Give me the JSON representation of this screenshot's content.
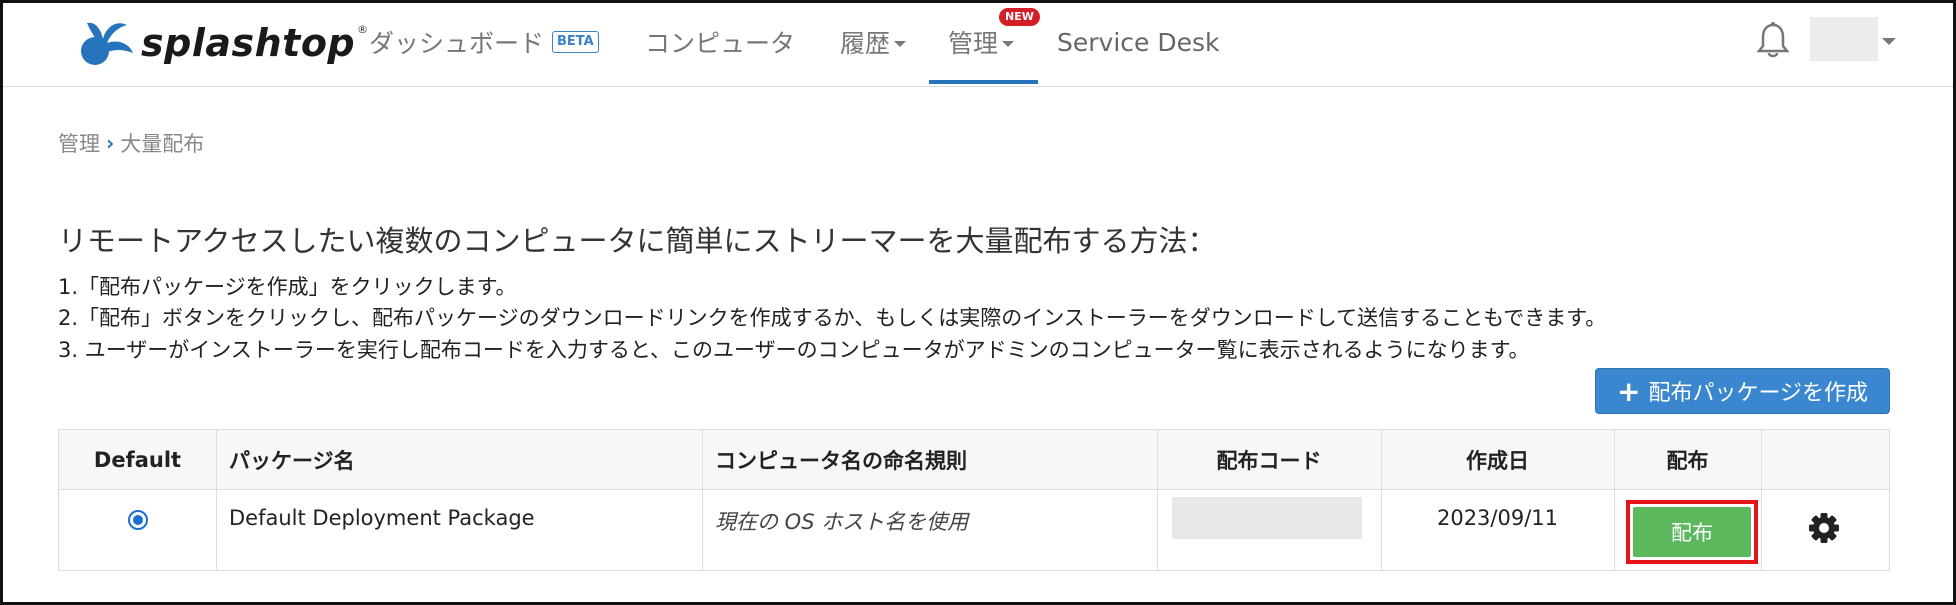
{
  "brand": {
    "name": "splashtop",
    "reg": "®"
  },
  "nav": {
    "dashboard": "ダッシュボード",
    "beta": "BETA",
    "computers": "コンピュータ",
    "history": "履歴",
    "manage": "管理",
    "new_badge": "NEW",
    "service_desk": "Service Desk"
  },
  "breadcrumb": {
    "parent": "管理",
    "separator": "›",
    "current": "大量配布"
  },
  "heading": "リモートアクセスしたい複数のコンピュータに簡単にストリーマーを大量配布する方法：",
  "steps": [
    "1.「配布パッケージを作成」をクリックします。",
    "2.「配布」ボタンをクリックし、配布パッケージのダウンロードリンクを作成するか、もしくは実際のインストーラーをダウンロードして送信することもできます。",
    "3. ユーザーがインストーラーを実行し配布コードを入力すると、このユーザーのコンピュータがアドミンのコンピューター覧に表示されるようになります。"
  ],
  "create_button": {
    "plus": "+",
    "label": "配布パッケージを作成"
  },
  "table": {
    "headers": [
      "Default",
      "パッケージ名",
      "コンピュータ名の命名規則",
      "配布コード",
      "作成日",
      "配布",
      ""
    ],
    "rows": [
      {
        "default_selected": true,
        "package_name": "Default Deployment Package",
        "naming_rule": "現在の OS ホスト名を使用",
        "deploy_code": "",
        "created": "2023/09/11",
        "deploy_label": "配布"
      }
    ]
  },
  "colors": {
    "accent": "#2574bc",
    "deploy": "#5cb85c",
    "highlight": "#e4141b",
    "badge": "#d51f26"
  },
  "icons": {
    "bell": "bell-icon",
    "gear": "gear-icon",
    "radio": "radio-selected-icon"
  }
}
